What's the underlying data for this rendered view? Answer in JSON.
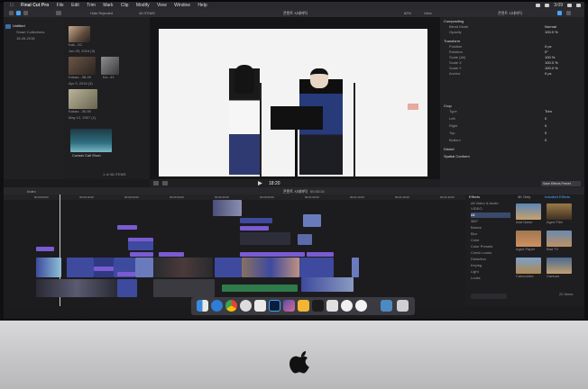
{
  "menubar": {
    "app": "Final Cut Pro",
    "items": [
      "File",
      "Edit",
      "Trim",
      "Mark",
      "Clip",
      "Modify",
      "View",
      "Window",
      "Help"
    ],
    "clock": "3:09"
  },
  "browser": {
    "library_name": "Untitled",
    "smart_collections": "Smart Collections",
    "event": "18-05-2018",
    "filter": "Hide Rejected",
    "count": "46 ITEMS",
    "groups": [
      {
        "date": "Jun 25, 2016",
        "count": "(3)"
      },
      {
        "date": "Apr 9, 2016",
        "count": "(3)"
      },
      {
        "date": "May 12, 2007",
        "count": "(1)"
      }
    ],
    "clip_labels": [
      "Kak...0C",
      "Kakao...38-49",
      "Ka...41",
      "Kakao...36-55"
    ],
    "last_clip": "Curtain Call Short",
    "selected": "1 of 46 ITEMS"
  },
  "viewer": {
    "project": "콘텐트 시네마틱",
    "zoom": "82%",
    "view": "View",
    "timecode": "18:20"
  },
  "inspector": {
    "title": "콘텐트 시네마틱",
    "sections": [
      {
        "name": "Compositing",
        "rows": [
          [
            "Blend Mode",
            "Normal"
          ],
          [
            "Opacity",
            "100.0 %"
          ]
        ]
      },
      {
        "name": "Transform",
        "rows": [
          [
            "Position",
            "0 px"
          ],
          [
            "Rotation",
            "0°"
          ],
          [
            "Scale (All)",
            "100 %"
          ],
          [
            "Scale X",
            "100.0 %"
          ],
          [
            "Scale Y",
            "100.0 %"
          ],
          [
            "Anchor",
            "0 px"
          ]
        ]
      },
      {
        "name": "Crop",
        "rows": [
          [
            "Type",
            "Trim"
          ],
          [
            "Left",
            "0"
          ],
          [
            "Right",
            "0"
          ],
          [
            "Top",
            "0"
          ],
          [
            "Bottom",
            "0"
          ]
        ]
      },
      {
        "name": "Distort",
        "rows": []
      },
      {
        "name": "Spatial Conform",
        "rows": []
      }
    ],
    "save_button": "Save Effects Preset"
  },
  "timeline": {
    "index": "Index",
    "project": "콘텐트 시네마틱",
    "duration": "00:33:10",
    "ruler": [
      "00:00:00:00",
      "00:00:10:00",
      "00:00:20:00",
      "00:00:30:00",
      "00:00:40:00",
      "00:00:50:00",
      "00:01:00:00",
      "00:01:10:00",
      "00:01:20:00",
      "00:01:30:00"
    ]
  },
  "effects": {
    "title": "Effects",
    "toggle": "4K Only",
    "installed": "Installed Effects",
    "categories": [
      "All Video & Audio",
      "VIDEO",
      "All",
      "360°",
      "Basics",
      "Blur",
      "Color",
      "Color Presets",
      "Comic Looks",
      "Distortion",
      "Keying",
      "Light",
      "Looks"
    ],
    "items": [
      "Add Noise",
      "Aged Film",
      "Aged Paper",
      "Bad TV",
      "Camcorder",
      "Cartoon"
    ],
    "count": "22 Items"
  },
  "colors": {
    "accent": "#4aa3ff",
    "clip_blue": "#3d4a9e",
    "audio_green": "#2f7a4a",
    "title_purple": "#7a5bd1"
  }
}
